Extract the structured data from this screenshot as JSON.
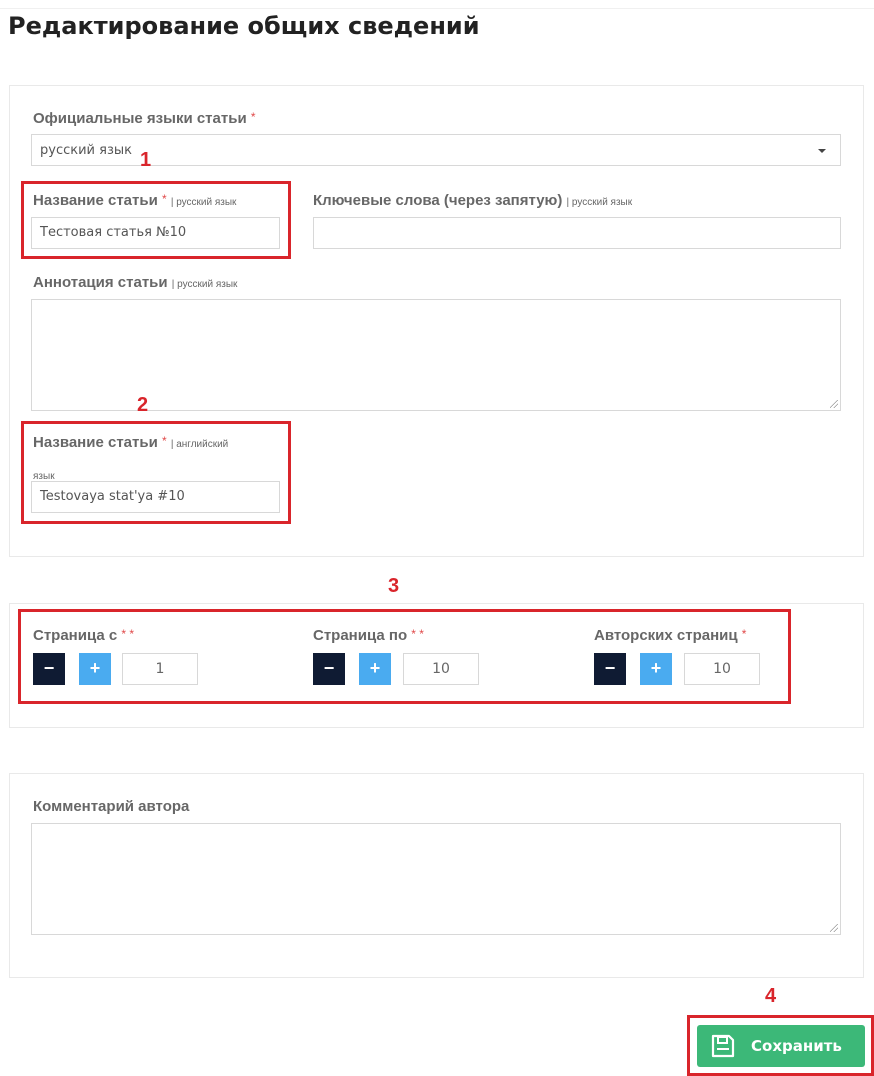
{
  "page": {
    "title": "Редактирование общих сведений"
  },
  "markers": [
    "1",
    "2",
    "3",
    "4"
  ],
  "general": {
    "languages": {
      "label": "Официальные языки статьи",
      "required": "*",
      "value": "русский язык"
    },
    "title_ru": {
      "label": "Название статьи",
      "required": "*",
      "lang": "| русский язык",
      "value": "Тестовая статья №10"
    },
    "keywords_ru": {
      "label": "Ключевые слова (через запятую)",
      "lang": "| русский язык",
      "value": ""
    },
    "abstract_ru": {
      "label": "Аннотация статьи",
      "lang": "| русский язык",
      "value": ""
    },
    "title_en": {
      "label": "Название статьи",
      "required": "*",
      "lang_line1": "| английский",
      "lang_line2": "язык",
      "value": "Testovaya stat'ya #10"
    }
  },
  "pages": {
    "minus": "−",
    "plus": "+",
    "page_from": {
      "label": "Страница с",
      "required": "* *",
      "value": "1"
    },
    "page_to": {
      "label": "Страница по",
      "required": "* *",
      "value": "10"
    },
    "author_pages": {
      "label": "Авторских страниц",
      "required": "*",
      "value": "10"
    }
  },
  "comment": {
    "label": "Комментарий автора",
    "value": ""
  },
  "actions": {
    "save_label": "Сохранить"
  },
  "colors": {
    "accent_red": "#d9252b",
    "save_green": "#3cb878",
    "minus_navy": "#0f1b33",
    "plus_blue": "#4aabf0"
  }
}
